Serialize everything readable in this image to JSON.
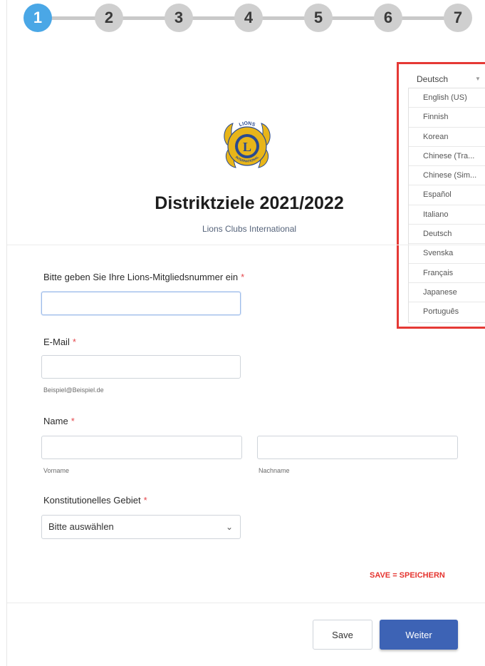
{
  "stepper": {
    "steps": [
      "1",
      "2",
      "3",
      "4",
      "5",
      "6",
      "7"
    ],
    "active_step": "1"
  },
  "language": {
    "current": "Deutsch",
    "options": [
      "English (US)",
      "Finnish",
      "Korean",
      "Chinese (Tra...",
      "Chinese (Sim...",
      "Español",
      "Italiano",
      "Deutsch",
      "Svenska",
      "Français",
      "Japanese",
      "Português"
    ]
  },
  "header": {
    "title": "Distriktziele 2021/2022",
    "subtitle": "Lions Clubs International",
    "logo_text": [
      "LIONS",
      "L",
      "INTERNATIONAL"
    ]
  },
  "form": {
    "member_number": {
      "label": "Bitte geben Sie Ihre Lions-Mitgliedsnummer ein",
      "required": "*",
      "value": ""
    },
    "email": {
      "label": "E-Mail",
      "required": "*",
      "value": "",
      "sublabel": "Beispiel@Beispiel.de"
    },
    "name": {
      "label": "Name",
      "required": "*",
      "first_value": "",
      "last_value": "",
      "first_sublabel": "Vorname",
      "last_sublabel": "Nachname"
    },
    "area": {
      "label": "Konstitutionelles Gebiet",
      "required": "*",
      "selected": "Bitte auswählen"
    }
  },
  "note": "SAVE = SPEICHERN",
  "buttons": {
    "save": "Save",
    "next": "Weiter"
  },
  "colors": {
    "active_step": "#4aa7e6",
    "primary_button": "#3d63b5",
    "required": "#e5484d",
    "highlight": "#e53935"
  }
}
